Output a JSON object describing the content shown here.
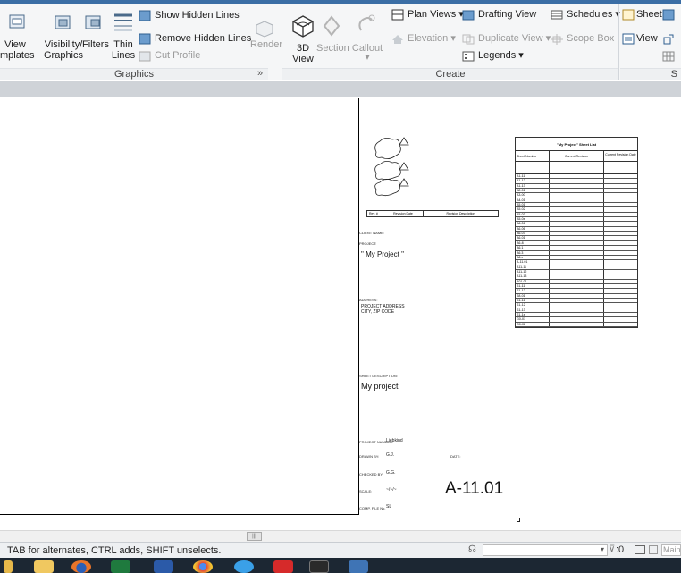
{
  "ribbon": {
    "view_templates_label_1": "View",
    "view_templates_label_2": "mplates",
    "visibility_label_1": "Visibility/",
    "visibility_label_2": "Graphics",
    "filters_label": "Filters",
    "thin_lines_label_1": "Thin",
    "thin_lines_label_2": "Lines",
    "show_hidden_lines": "Show  Hidden Lines",
    "remove_hidden_lines": "Remove  Hidden Lines",
    "cut_profile": "Cut Profile",
    "render_label": "Render",
    "view_3d_label_1": "3D",
    "view_3d_label_2": "View",
    "section_label": "Section",
    "callout_label": "Callout",
    "plan_views": "Plan Views",
    "drafting_view": "Drafting View",
    "schedules": "Schedules",
    "elevation": "Elevation",
    "duplicate_view": "Duplicate View",
    "scope_box": "Scope Box",
    "legends": "Legends",
    "sheet": "Sheet",
    "view": "View",
    "graphics_panel": "Graphics",
    "create_panel": "Create",
    "panel_expand": "»"
  },
  "sheet": {
    "rev_col": "Rev. #",
    "revision_date_col": "Revision Date",
    "revision_description_col": "Revision Description",
    "client_name_label": "CLIENT NAME:",
    "project_label": "PROJECT:",
    "project_name": "\" My Project \"",
    "address_label": "ADDRESS:",
    "project_address_1": "PROJECT ADDRESS",
    "project_address_2": "CITY, ZIP CODE",
    "sheet_description_label": "SHEET DESCRIPTION:",
    "sheet_description": "My project",
    "project_number_label": "PROJECT NUMBER:",
    "project_number": "Liebkind",
    "drawn_by_label": "DRAWN BY:",
    "drawn_by": "G.J.",
    "date_label": "DATE:",
    "checked_by_label": "CHECKED BY:",
    "checked_by": "G.G.",
    "scale_label": "SCALE:",
    "scale": "~/~/~",
    "sheet_number": "A-11.01",
    "comp_file_label": "COMP. FILE No.",
    "comp_file": "SL"
  },
  "sheet_list": {
    "title": "\"My Project\" Sheet List",
    "col_sheet_number": "Sheet Number",
    "col_current_revision": "Current Revision",
    "col_current_revision_date": "Current Revision Date",
    "rows": [
      "A1-11",
      "A1-12",
      "A1-13",
      "A2-01",
      "A3-00",
      "A4-01",
      "A5-01",
      "A5-02",
      "A5-03",
      "A5-0x",
      "A6-06",
      "A6-06",
      "A6-07",
      "A6-01",
      "A6-8",
      "A6.1",
      "A6.3",
      "A6.x",
      "A-11.01",
      "A11-11",
      "A11-12",
      "A11-13",
      "A01-01",
      "S1-11",
      "S1-12",
      "S8-01",
      "S1-11",
      "S1-12",
      "S1-13",
      "S1-1x",
      "G0-01",
      "G0-02"
    ]
  },
  "status": {
    "hint": "TAB for alternates, CTRL adds, SHIFT unselects.",
    "selection_count": ":0",
    "model": "Main"
  },
  "icons": [
    "view-templates-icon",
    "visibility-graphics-icon",
    "filters-icon",
    "thin-lines-icon",
    "show-hidden-lines-icon",
    "remove-hidden-lines-icon",
    "cut-profile-icon",
    "render-icon",
    "3d-view-icon",
    "section-icon",
    "callout-icon",
    "plan-views-icon",
    "drafting-view-icon",
    "schedules-icon",
    "elevation-icon",
    "duplicate-view-icon",
    "scope-box-icon",
    "legends-icon",
    "sheet-icon",
    "view-icon",
    "revision-cloud-icon",
    "file-explorer-icon",
    "firefox-icon",
    "excel-icon",
    "word-icon",
    "chrome-icon",
    "ie-icon",
    "acrobat-icon",
    "kindle-icon",
    "revit-icon"
  ]
}
